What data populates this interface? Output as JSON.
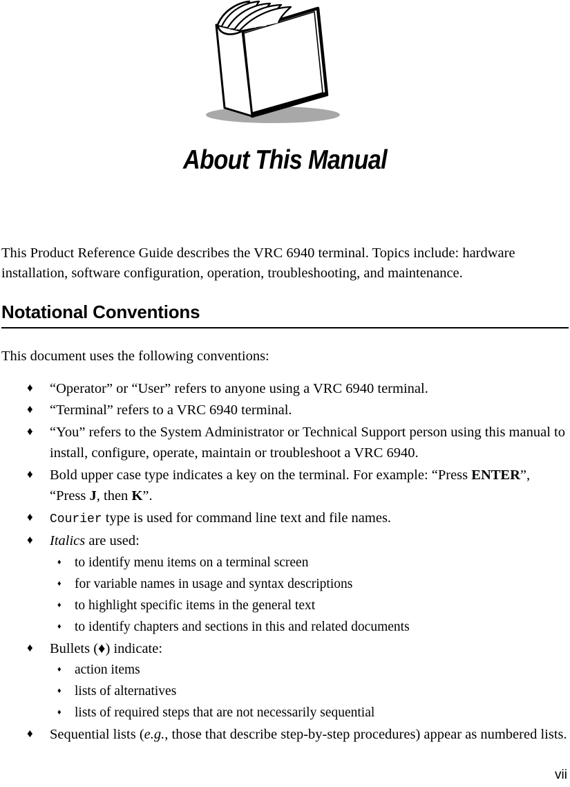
{
  "page": {
    "number": "vii",
    "chapter_title": "About This Manual",
    "figure": {
      "name": "open-book-illustration",
      "shadow_color": "#a8a8a8",
      "line_color": "#000000"
    }
  },
  "intro": {
    "paragraph": "This Product Reference Guide describes the VRC 6940 terminal. Topics include: hardware installation, software configuration, operation, troubleshooting, and maintenance."
  },
  "section": {
    "heading": "Notational Conventions",
    "lead": "This document uses the following conventions:"
  },
  "bullets": {
    "diamond_glyph": "♦",
    "sub_glyph": "♦",
    "items": [
      {
        "id": "operator-user",
        "text": "“Operator” or “User” refers to anyone using a VRC 6940 terminal."
      },
      {
        "id": "terminal",
        "text": "“Terminal” refers to a VRC 6940 terminal."
      },
      {
        "id": "you",
        "text": "“You” refers to the System Administrator or Technical Support person using this manual to install, configure, operate, maintain or troubleshoot a VRC 6940."
      },
      {
        "id": "bold-upper-case",
        "text_before": "Bold upper case type indicates a key on the terminal. For example: “Press ",
        "key_1": "ENTER",
        "text_middle": "”, “Press ",
        "key_2": "J",
        "text_middle_2": ", then ",
        "key_3": "K",
        "text_after": "”."
      },
      {
        "id": "courier",
        "mono_word": "Courier",
        "text_after": " type is used for command line text and file names."
      },
      {
        "id": "italics",
        "italic_word": "Italics",
        "text_after": " are used:",
        "sub_items": [
          "to identify menu items on a terminal screen",
          "for variable names in usage and syntax descriptions",
          "to highlight specific items in the general text",
          "to identify chapters and sections in this and related documents"
        ]
      },
      {
        "id": "bullets-indicate",
        "text_before": "Bullets (",
        "inline_glyph": "♦",
        "text_after": ") indicate:",
        "sub_items": [
          "action items",
          "lists of alternatives",
          "lists of required steps that are not necessarily sequential"
        ]
      },
      {
        "id": "sequential-lists",
        "text_before": "Sequential lists (",
        "italic_word": "e.g.",
        "text_after": ", those that describe step-by-step procedures) appear as numbered lists."
      }
    ]
  }
}
